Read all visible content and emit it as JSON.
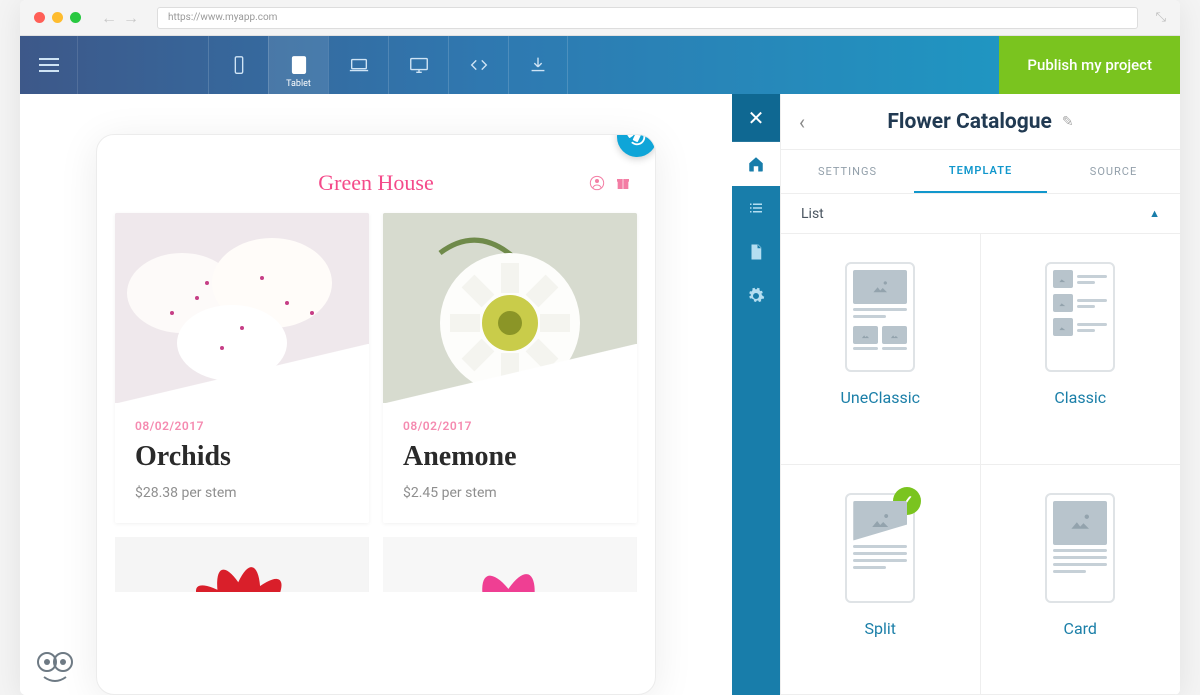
{
  "browser": {
    "url": "https://www.myapp.com"
  },
  "toolbar": {
    "device_label": "Tablet",
    "publish": "Publish my project"
  },
  "site": {
    "brand": "Green House",
    "cards": [
      {
        "date": "08/02/2017",
        "title": "Orchids",
        "price": "$28.38 per stem"
      },
      {
        "date": "08/02/2017",
        "title": "Anemone",
        "price": "$2.45 per stem"
      }
    ]
  },
  "panel": {
    "title": "Flower Catalogue",
    "tabs": {
      "settings": "SETTINGS",
      "template": "TEMPLATE",
      "source": "SOURCE"
    },
    "section": "List",
    "templates": [
      {
        "label": "UneClassic"
      },
      {
        "label": "Classic"
      },
      {
        "label": "Split"
      },
      {
        "label": "Card"
      }
    ]
  }
}
